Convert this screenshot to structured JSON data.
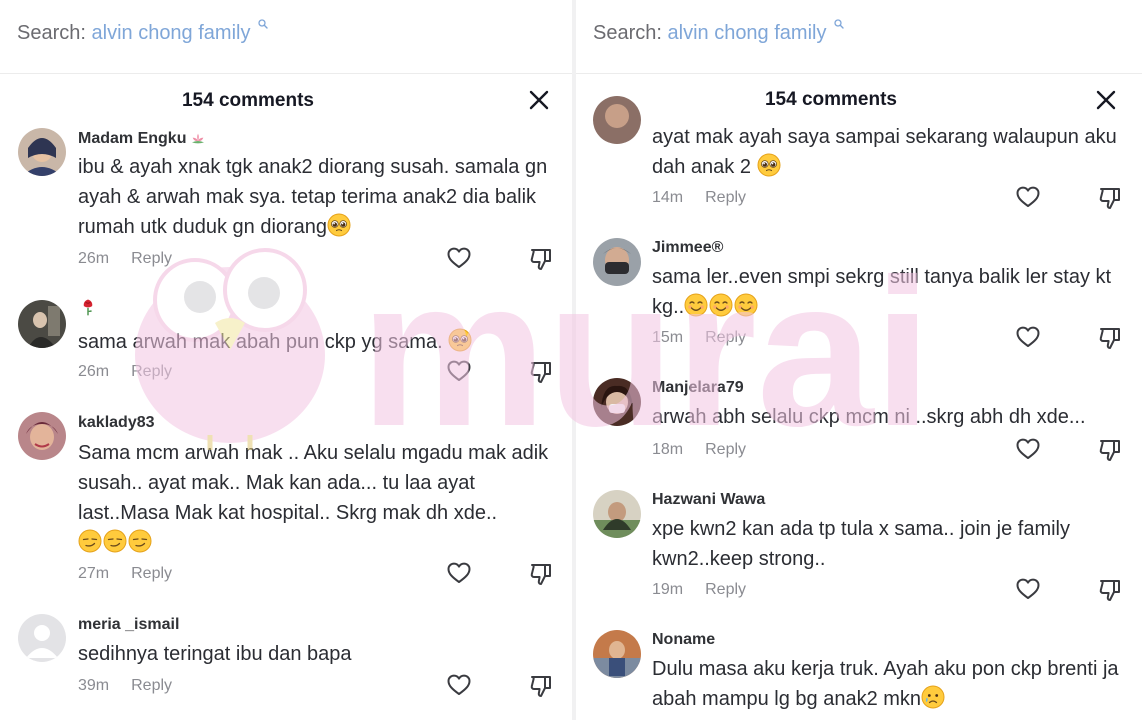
{
  "search": {
    "label": "Search:",
    "query": "alvin chong family"
  },
  "sheet": {
    "title": "154 comments"
  },
  "watermark_text": "murai",
  "left_comments": [
    {
      "username": "Madam Engku",
      "text": "ibu & ayah xnak tgk anak2 diorang susah. samala gn ayah & arwah mak sya. tetap terima anak2 dia balik rumah utk duduk gn diorang",
      "time": "26m",
      "reply": "Reply"
    },
    {
      "username": "",
      "text": "sama arwah mak abah pun ckp yg sama.",
      "time": "26m",
      "reply": "Reply"
    },
    {
      "username": "kaklady83",
      "text": "Sama mcm arwah mak .. Aku selalu mgadu mak adik susah.. ayat mak.. Mak kan ada... tu laa ayat last..Masa Mak kat hospital.. Skrg mak dh xde..",
      "time": "27m",
      "reply": "Reply"
    },
    {
      "username": "meria _ismail",
      "text": "sedihnya teringat ibu dan bapa",
      "time": "39m",
      "reply": "Reply"
    }
  ],
  "right_comments": [
    {
      "username": "",
      "text": "ayat mak ayah saya sampai sekarang walaupun aku dah anak 2",
      "time": "14m",
      "reply": "Reply"
    },
    {
      "username": "Jimmee®",
      "text": "sama ler..even smpi sekrg still tanya balik ler stay kt kg..",
      "time": "15m",
      "reply": "Reply"
    },
    {
      "username": "Manjelara79",
      "text": "arwah abh selalu ckp mcm ni ..skrg abh dh xde...",
      "time": "18m",
      "reply": "Reply"
    },
    {
      "username": "Hazwani Wawa",
      "text": "xpe kwn2 kan ada tp tula x sama.. join je family kwn2..keep strong..",
      "time": "19m",
      "reply": "Reply"
    },
    {
      "username": "Noname",
      "text": "Dulu masa aku kerja truk. Ayah aku pon ckp brenti ja abah mampu lg bg anak2 mkn",
      "time": "",
      "reply": ""
    }
  ],
  "colors": {
    "search_query": "#7fa6d8",
    "meta_gray": "#8a8b91",
    "text_dark": "#161823",
    "watermark_pink": "#f3c6e3"
  },
  "icons": [
    "search-icon",
    "close-icon",
    "heart-icon",
    "dislike-icon",
    "lotus-emoji",
    "rose-emoji",
    "pleading-face-emoji",
    "smiling-face-emoji",
    "smirking-face-emoji",
    "sad-face-emoji"
  ]
}
